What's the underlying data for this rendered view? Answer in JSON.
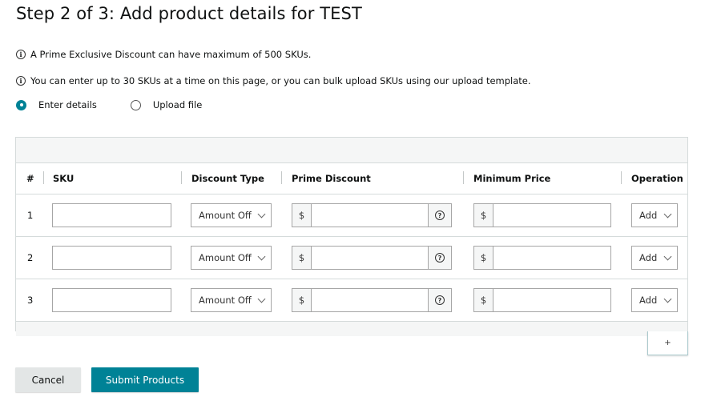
{
  "page": {
    "title": "Step 2 of 3: Add product details for TEST",
    "info": [
      {
        "icon": "info-icon",
        "text": "A Prime Exclusive Discount can have maximum of 500 SKUs."
      },
      {
        "icon": "info-icon",
        "text": "You can enter up to 30 SKUs at a time on this page, or you can bulk upload SKUs using our upload template."
      }
    ],
    "info_glyph": "i",
    "mode_options": [
      {
        "label": "Enter details",
        "selected": true
      },
      {
        "label": "Upload file",
        "selected": false
      }
    ]
  },
  "table": {
    "columns": [
      "#",
      "SKU",
      "Discount Type",
      "Prime Discount",
      "Minimum Price",
      "Operation"
    ],
    "currency_symbol": "$",
    "help_glyph": "?",
    "rows": [
      {
        "num": "1",
        "sku": "",
        "discount_type": "Amount Off",
        "prime_discount": "",
        "minimum_price": "",
        "operation": "Add"
      },
      {
        "num": "2",
        "sku": "",
        "discount_type": "Amount Off",
        "prime_discount": "",
        "minimum_price": "",
        "operation": "Add"
      },
      {
        "num": "3",
        "sku": "",
        "discount_type": "Amount Off",
        "prime_discount": "",
        "minimum_price": "",
        "operation": "Add"
      }
    ],
    "add_row_label": "+"
  },
  "actions": {
    "cancel_label": "Cancel",
    "submit_label": "Submit Products"
  },
  "colors": {
    "accent": "#008296",
    "cancel_bg": "#e3e6e6"
  }
}
